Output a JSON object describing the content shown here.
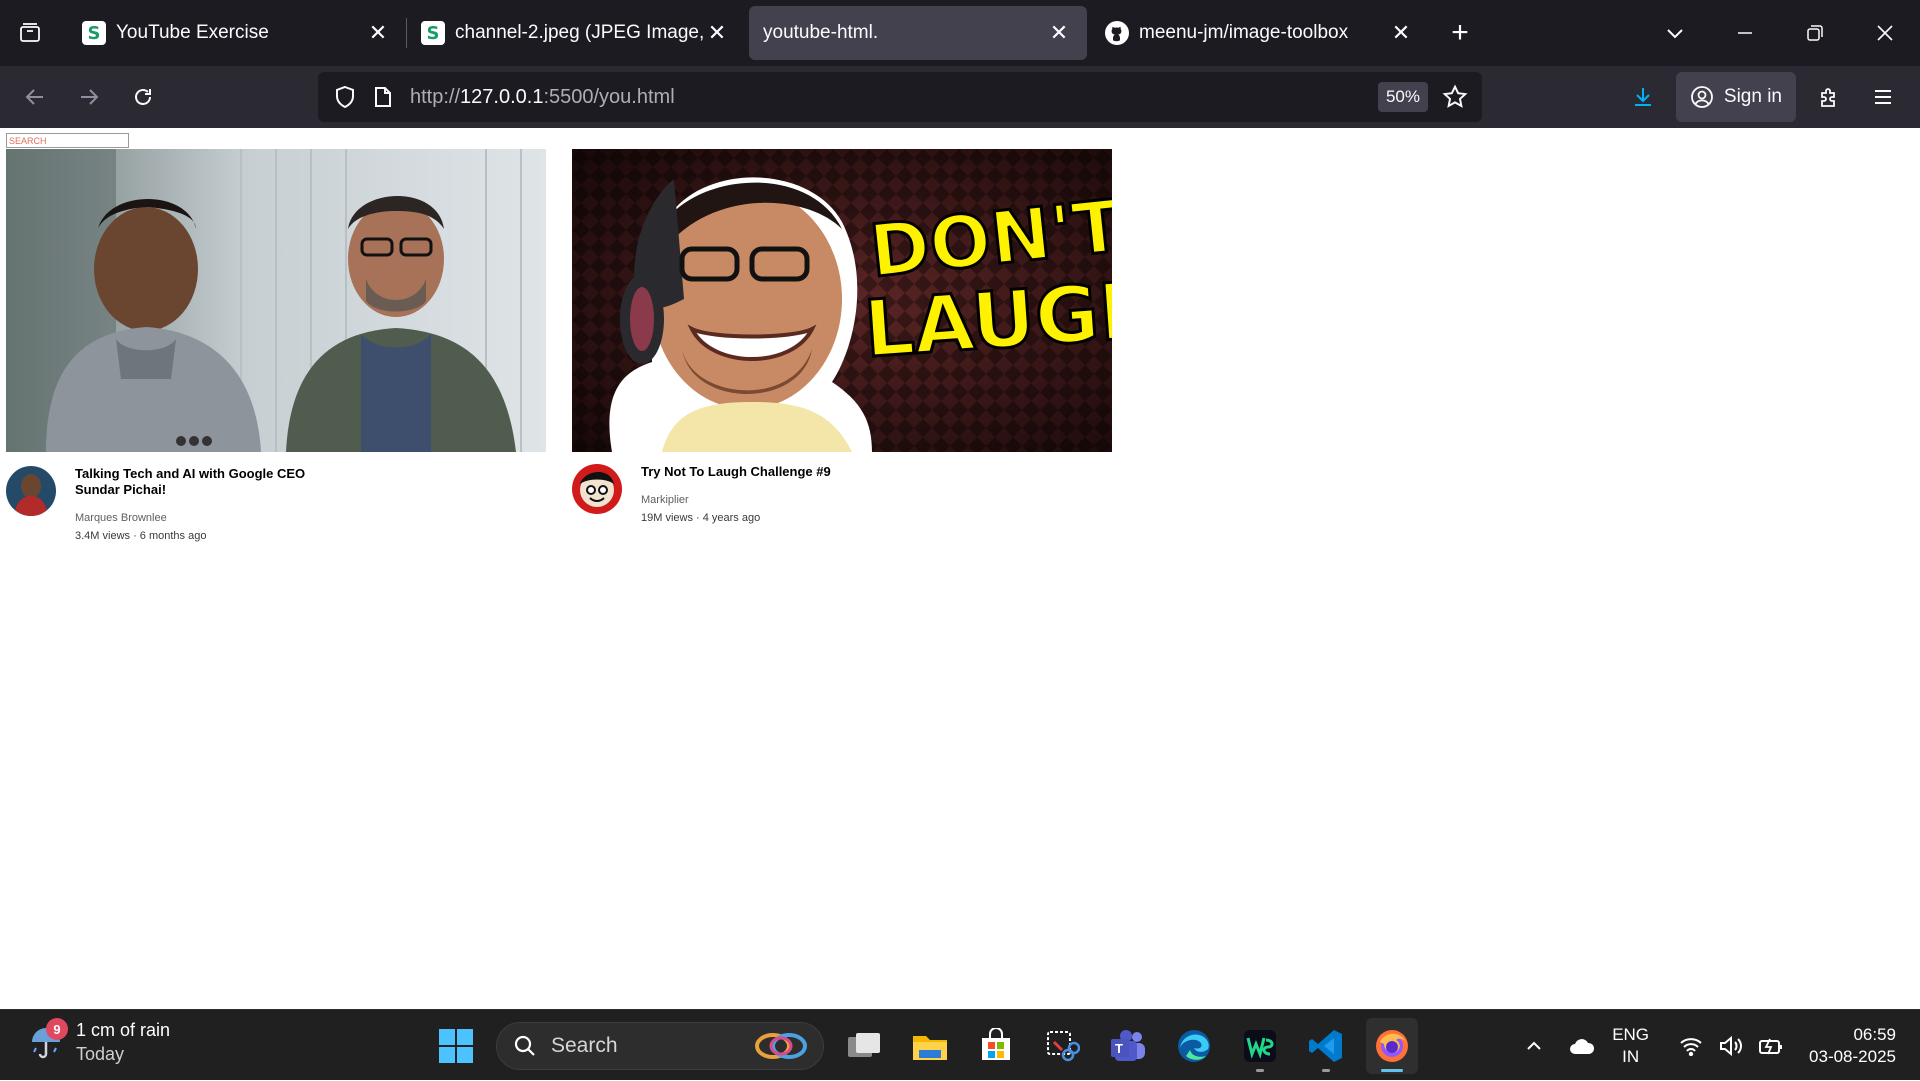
{
  "browser": {
    "tabs": [
      {
        "title": "YouTube Exercise",
        "favicon": "s-favicon",
        "active": false
      },
      {
        "title": "channel-2.jpeg (JPEG Image, 68",
        "favicon": "s-favicon",
        "active": false
      },
      {
        "title": "youtube-html.",
        "favicon": "none",
        "active": true
      },
      {
        "title": "meenu-jm/image-toolbox",
        "favicon": "github-icon",
        "active": false
      }
    ],
    "url_prefix": "http://",
    "url_host": "127.0.0.1",
    "url_rest": ":5500/you.html",
    "zoom": "50%",
    "sign_in_label": "Sign in"
  },
  "page": {
    "search_placeholder": "SEARCH",
    "videos": [
      {
        "title": "Talking Tech and AI with Google CEO Sundar Pichai!",
        "channel": "Marques Brownlee",
        "stats": "3.4M views · 6 months ago"
      },
      {
        "title": "Try Not To Laugh Challenge #9",
        "channel": "Markiplier",
        "stats": "19M views · 4 years ago",
        "thumb_text_line1": "DON'T",
        "thumb_text_line2": "LAUGH"
      }
    ]
  },
  "taskbar": {
    "weather_badge": "9",
    "weather_line1": "1 cm of rain",
    "weather_line2": "Today",
    "search_label": "Search",
    "lang_line1": "ENG",
    "lang_line2": "IN",
    "time": "06:59",
    "date": "03-08-2025"
  },
  "colors": {
    "tabstrip_bg": "#1c1b22",
    "navbar_bg": "#2b2a33",
    "active_tab_bg": "#42414d",
    "taskbar_bg": "#202020",
    "download_accent": "#00b3f4",
    "thumb_text_yellow": "#fff200"
  }
}
